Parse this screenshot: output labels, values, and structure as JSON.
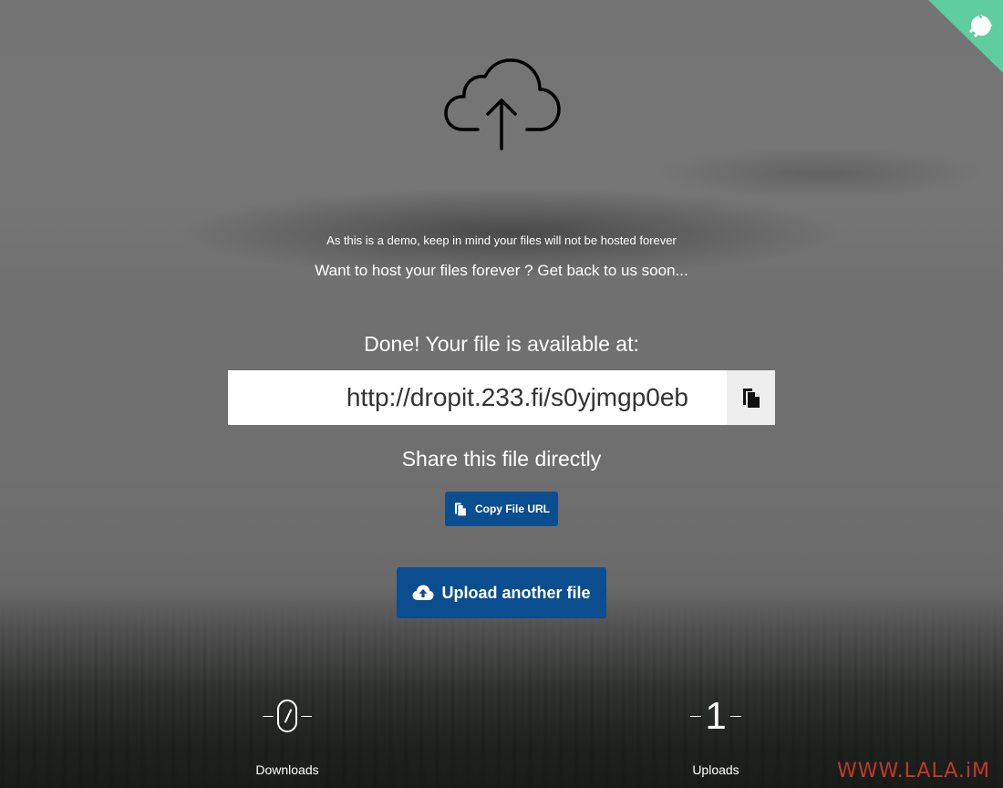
{
  "header": {
    "cloud_icon": "cloud-upload-icon",
    "corner_icon": "github-cat-icon",
    "corner_color": "#5fcda0"
  },
  "notices": {
    "demo": "As this is a demo, keep in mind your files will not be hosted forever",
    "forever": "Want to host your files forever ? Get back to us soon..."
  },
  "result": {
    "heading": "Done! Your file is available at:",
    "url": "http://dropit.233.fi/s0yjmgp0eb",
    "copy_icon": "copy-icon"
  },
  "share": {
    "heading": "Share this file directly",
    "copy_button": "Copy File URL",
    "upload_button": "Upload another file",
    "button_color": "#0a4e8f"
  },
  "stats": {
    "downloads": {
      "value": "0",
      "label": "Downloads"
    },
    "uploads": {
      "value": "1",
      "label": "Uploads"
    }
  },
  "watermark": "WWW.LALA.iM"
}
